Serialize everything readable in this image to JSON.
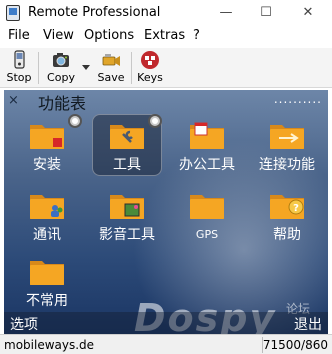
{
  "window": {
    "title": "Remote Professional",
    "min_glyph": "—",
    "max_glyph": "☐",
    "close_glyph": "✕"
  },
  "menu": {
    "items": [
      {
        "label": "File"
      },
      {
        "label": "View"
      },
      {
        "label": "Options"
      },
      {
        "label": "Extras"
      },
      {
        "label": "?"
      }
    ]
  },
  "toolbar": {
    "stop_label": "Stop",
    "copy_label": "Copy",
    "save_label": "Save",
    "keys_label": "Keys",
    "icons": {
      "stop": "stop-phone-icon",
      "copy": "camera-icon",
      "save": "video-camera-icon",
      "keys": "keys-icon"
    }
  },
  "phone": {
    "close_glyph": "×",
    "title": "功能表",
    "counter": "..........",
    "items": [
      {
        "label": "安装",
        "icon": "folder-install-icon",
        "selected": false
      },
      {
        "label": "工具",
        "icon": "folder-tools-icon",
        "selected": true
      },
      {
        "label": "办公工具",
        "icon": "folder-office-icon",
        "selected": false
      },
      {
        "label": "连接功能",
        "icon": "folder-connect-icon",
        "selected": false
      },
      {
        "label": "通讯",
        "icon": "folder-communication-icon",
        "selected": false
      },
      {
        "label": "影音工具",
        "icon": "folder-media-icon",
        "selected": false
      },
      {
        "label": "GPS",
        "icon": "folder-gps-icon",
        "selected": false
      },
      {
        "label": "帮助",
        "icon": "folder-help-icon",
        "selected": false
      },
      {
        "label": "不常用",
        "icon": "folder-misc-icon",
        "selected": false
      }
    ],
    "soft_left": "选项",
    "soft_right": "退出",
    "watermark": "Dospy",
    "watermark_small": "论坛"
  },
  "status": {
    "left": "mobileways.de",
    "right": "71500/860"
  },
  "colors": {
    "folder": "#f5a623",
    "folder_dark": "#d8891a",
    "phone_bg": "#2c4a78",
    "keys_red": "#c0282d"
  }
}
